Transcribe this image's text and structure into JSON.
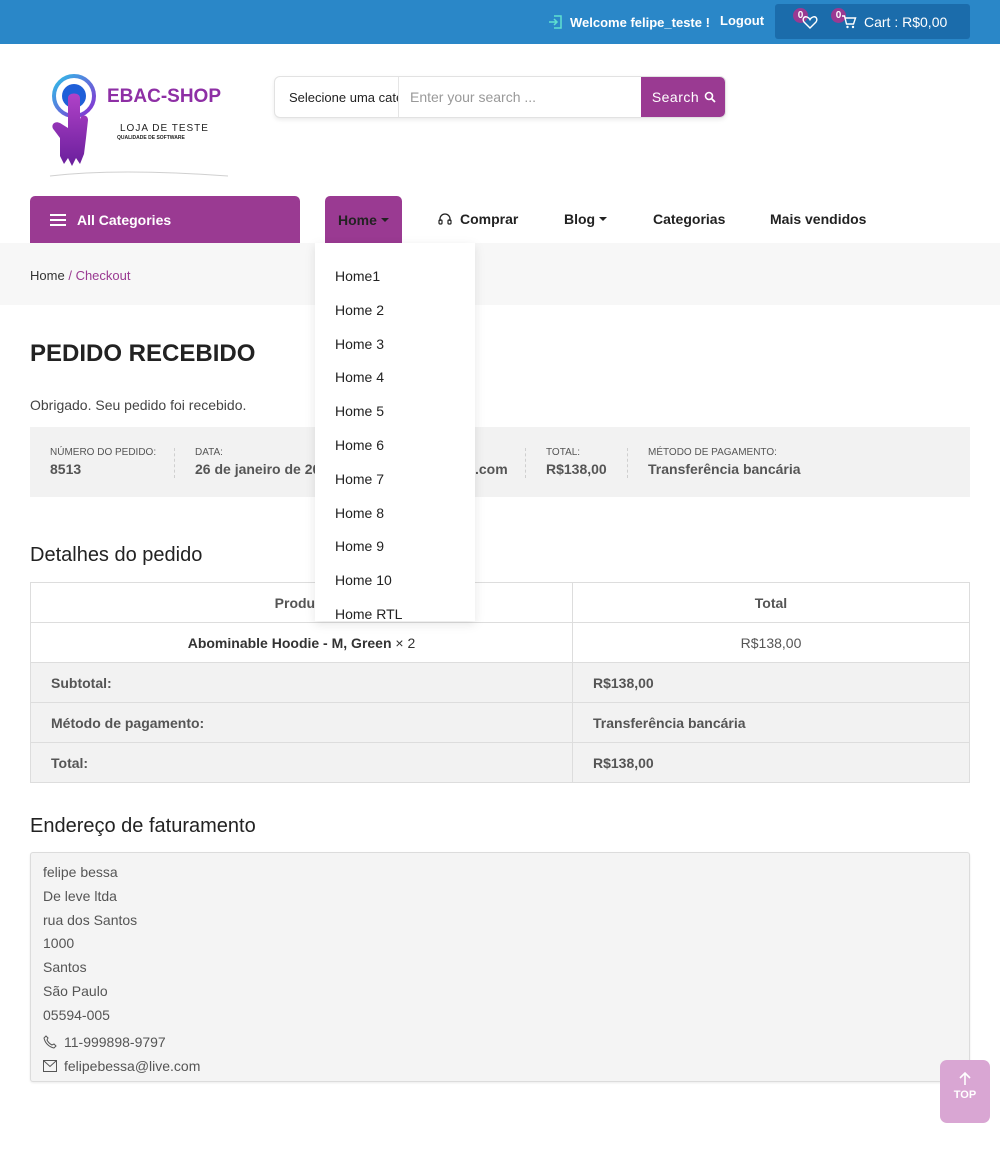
{
  "topbar": {
    "welcome": "Welcome felipe_teste !",
    "logout": "Logout",
    "wishlist_count": "0",
    "cart_count": "0",
    "cart_label": "Cart : R$0,00"
  },
  "logo": {
    "title": "EBAC-SHOP",
    "subtitle": "LOJA DE TESTE",
    "tagline": "QUALIDADE DE SOFTWARE"
  },
  "search": {
    "category": "Selecione uma categoria",
    "placeholder": "Enter your search ...",
    "button": "Search"
  },
  "nav": {
    "all_categories": "All Categories",
    "items": [
      "Home",
      "Comprar",
      "Blog",
      "Categorias",
      "Mais vendidos"
    ]
  },
  "dropdown": {
    "items": [
      "Home1",
      "Home 2",
      "Home 3",
      "Home 4",
      "Home 5",
      "Home 6",
      "Home 7",
      "Home 8",
      "Home 9",
      "Home 10",
      "Home RTL"
    ]
  },
  "breadcrumb": {
    "home": "Home",
    "separator": "/",
    "current": "Checkout"
  },
  "order": {
    "title": "PEDIDO RECEBIDO",
    "thanks": "Obrigado. Seu pedido foi recebido.",
    "overview": [
      {
        "label": "NÚMERO DO PEDIDO:",
        "value": "8513"
      },
      {
        "label": "DATA:",
        "value": "26 de janeiro de 20"
      },
      {
        "label": "",
        "value": ".com"
      },
      {
        "label": "TOTAL:",
        "value": "R$138,00"
      },
      {
        "label": "MÉTODO DE PAGAMENTO:",
        "value": "Transferência bancária"
      }
    ]
  },
  "details": {
    "heading": "Detalhes do pedido",
    "col_product": "Produto",
    "col_total": "Total",
    "item_name": "Abominable Hoodie - M, Green",
    "item_qty": " × 2",
    "item_price": "R$138,00",
    "rows": [
      {
        "label": "Subtotal:",
        "value": "R$138,00"
      },
      {
        "label": "Método de pagamento:",
        "value": "Transferência bancária"
      },
      {
        "label": "Total:",
        "value": "R$138,00"
      }
    ]
  },
  "billing": {
    "heading": "Endereço de faturamento",
    "lines": [
      "felipe bessa",
      "De leve ltda",
      "rua dos Santos",
      "1000",
      "Santos",
      "São Paulo",
      "05594-005"
    ],
    "phone": "11-999898-9797",
    "email": "felipebessa@live.com"
  },
  "back_to_top": "TOP",
  "colors": {
    "topbar": "#2a87c8",
    "accent": "#9a3a92",
    "cart_box": "#1b6cab"
  }
}
